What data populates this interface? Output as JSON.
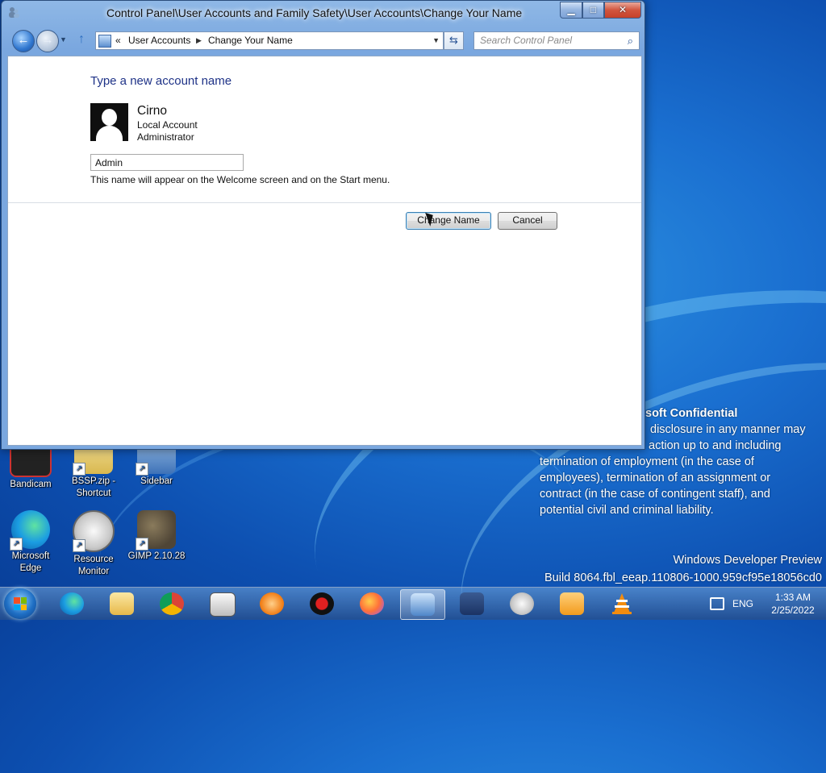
{
  "window": {
    "title": "Control Panel\\User Accounts and Family Safety\\User Accounts\\Change Your Name",
    "caption_min": "▁",
    "caption_max": "□",
    "caption_close": "✕"
  },
  "navbar": {
    "breadcrumb_overflow": "«",
    "breadcrumbs": [
      "User Accounts",
      "Change Your Name"
    ],
    "search_placeholder": "Search Control Panel"
  },
  "page": {
    "heading": "Type a new account name",
    "user_name": "Cirno",
    "account_type": "Local Account",
    "account_role": "Administrator",
    "new_name_value": "Admin",
    "hint": "This name will appear on the Welcome screen and on the Start menu.",
    "change_button": "Change Name",
    "cancel_button": "Cancel"
  },
  "desktop": {
    "icons": [
      {
        "name": "Bandicam",
        "icon": "bandicam-icon"
      },
      {
        "name": "BSSP.zip - Shortcut",
        "icon": "zip-shortcut-icon"
      },
      {
        "name": "Sidebar",
        "icon": "sidebar-icon"
      },
      {
        "name": "Microsoft Edge",
        "icon": "edge-icon"
      },
      {
        "name": "Resource Monitor",
        "icon": "resource-monitor-icon"
      },
      {
        "name": "GIMP 2.10.28",
        "icon": "gimp-icon"
      }
    ],
    "confidential_heading": "soft Confidential",
    "confidential_lines": [
      "disclosure in any manner may",
      "action up to and including",
      "termination of employment (in the case of",
      "employees), termination of an assignment or",
      "contract (in the case of contingent staff), and",
      "potential civil and criminal liability."
    ],
    "watermark_line1": "Windows Developer Preview",
    "watermark_line2": "Build 8064.fbl_eeap.110806-1000.959cf95e18056cd0"
  },
  "taskbar": {
    "apps": [
      "edge-icon",
      "file-explorer-icon",
      "chrome-icon",
      "media-player-classic-icon",
      "avast-icon",
      "bandicam-record-icon",
      "firefox-icon",
      "control-panel-icon",
      "security-center-icon",
      "resource-monitor-icon",
      "media-player-icon",
      "vlc-icon"
    ],
    "language": "ENG",
    "time": "1:33 AM",
    "date": "2/25/2022"
  },
  "colors": {
    "heading_text": "#1e3287",
    "desktop_blue": "#1a6fd0",
    "window_frame": "#7aa7df",
    "close_button": "#c5412a"
  }
}
